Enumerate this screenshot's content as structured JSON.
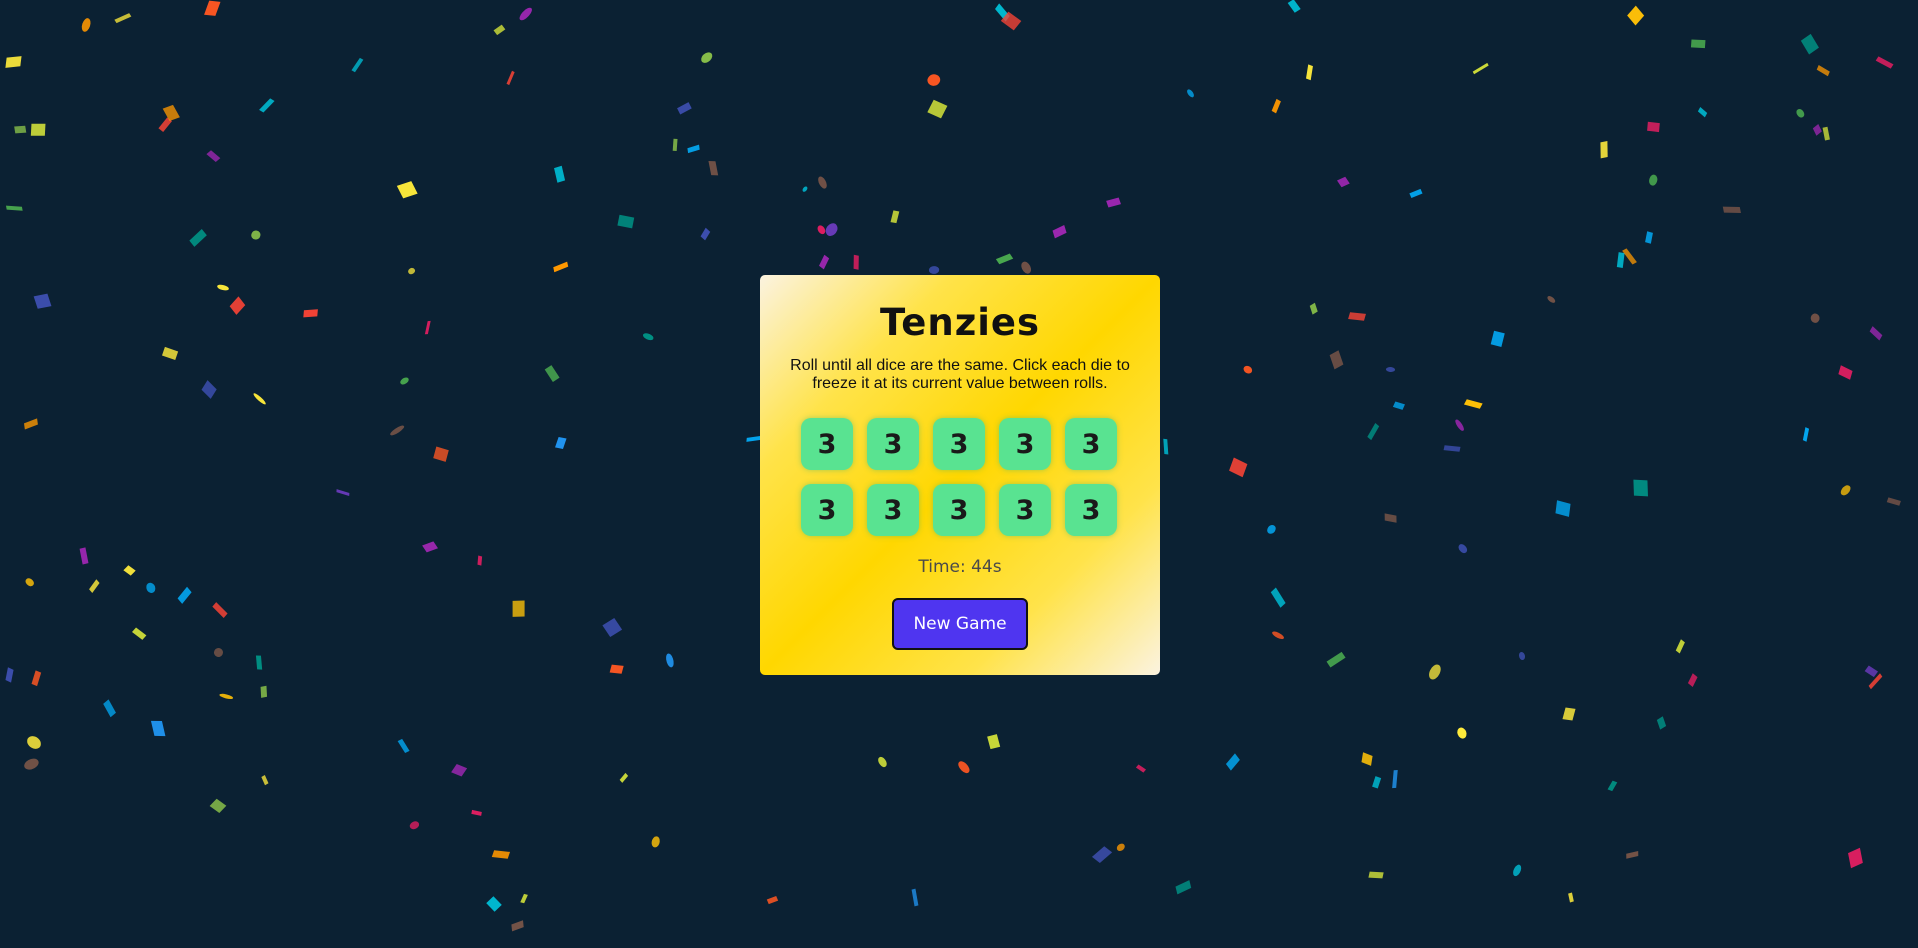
{
  "game": {
    "title": "Tenzies",
    "instructions": "Roll until all dice are the same. Click each die to freeze it at its current value between rolls.",
    "dice": [
      "3",
      "3",
      "3",
      "3",
      "3",
      "3",
      "3",
      "3",
      "3",
      "3"
    ],
    "timer_text": "Time: 44s",
    "new_game_label": "New Game"
  },
  "colors": {
    "background": "#0b2133",
    "card_gradient_light": "#fbf3e0",
    "card_gradient_gold": "#ffd700",
    "die_held": "#59e391",
    "button": "#4f35f0",
    "confetti_palette": [
      "#f44336",
      "#e91e63",
      "#9c27b0",
      "#673ab7",
      "#3f51b5",
      "#2196f3",
      "#03a9f4",
      "#00bcd4",
      "#009688",
      "#4caf50",
      "#8bc34a",
      "#cddc39",
      "#ffeb3b",
      "#ffc107",
      "#ff9800",
      "#ff5722",
      "#795548"
    ]
  }
}
